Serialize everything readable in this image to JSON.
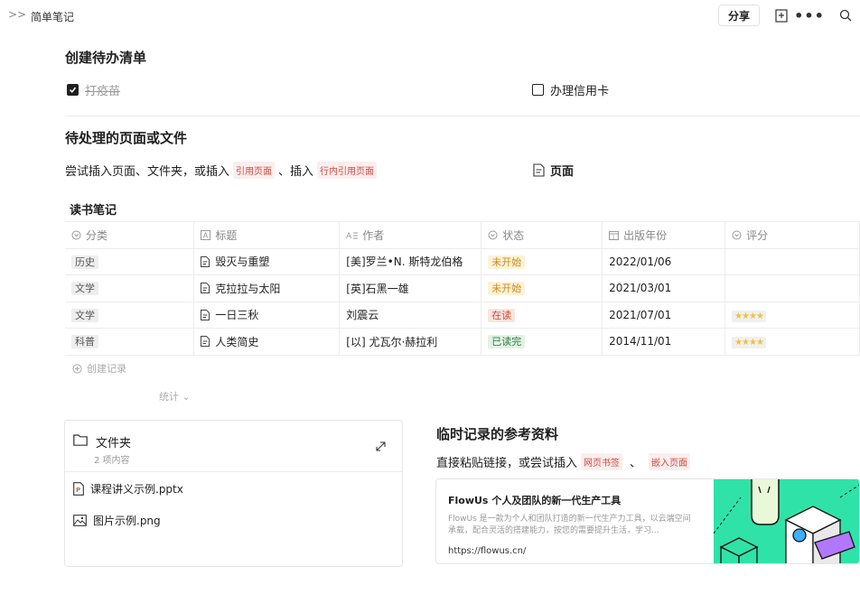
{
  "topbar": {
    "title": "简单笔记",
    "share_label": "分享"
  },
  "todo_section": {
    "heading": "创建待办清单",
    "items": [
      {
        "label": "打疫苗",
        "checked": true
      },
      {
        "label": "办理信用卡",
        "checked": false
      }
    ]
  },
  "pending_section": {
    "heading": "待处理的页面或文件",
    "text_before": "尝试插入页面、文件夹，或插入",
    "tag1": "引用页面",
    "text_mid": "、插入",
    "tag2": "行内引用页面",
    "page_link": "页面"
  },
  "database": {
    "title": "读书笔记",
    "columns": [
      {
        "label": "分类",
        "icon": "select-icon"
      },
      {
        "label": "标题",
        "icon": "text-icon"
      },
      {
        "label": "作者",
        "icon": "text-lines-icon"
      },
      {
        "label": "状态",
        "icon": "select-icon"
      },
      {
        "label": "出版年份",
        "icon": "calendar-icon"
      },
      {
        "label": "评分",
        "icon": "select-icon"
      }
    ],
    "rows": [
      {
        "category": "历史",
        "title": "毁灭与重塑",
        "author": "[美]罗兰•N. 斯特龙伯格",
        "status": "未开始",
        "status_color": "orange",
        "year": "2022/01/06",
        "rating": ""
      },
      {
        "category": "文学",
        "title": "克拉拉与太阳",
        "author": "[英]石黑一雄",
        "status": "未开始",
        "status_color": "orange",
        "year": "2021/03/01",
        "rating": ""
      },
      {
        "category": "文学",
        "title": "一日三秋",
        "author": "刘震云",
        "status": "在读",
        "status_color": "red",
        "year": "2021/07/01",
        "rating": "★★★★"
      },
      {
        "category": "科普",
        "title": "人类简史",
        "author": "[以] 尤瓦尔·赫拉利",
        "status": "已读完",
        "status_color": "green",
        "year": "2014/11/01",
        "rating": "★★★★"
      }
    ],
    "create_label": "创建记录",
    "stats_label": "统计"
  },
  "folder": {
    "name": "文件夹",
    "count": "2 项内容",
    "files": [
      {
        "name": "课程讲义示例.pptx",
        "icon": "pptx-file-icon"
      },
      {
        "name": "图片示例.png",
        "icon": "image-file-icon"
      }
    ]
  },
  "reference": {
    "heading": "临时记录的参考资料",
    "text_before": "直接粘贴链接，或尝试插入",
    "tag1": "网页书签",
    "sep": "、",
    "tag2": "嵌入页面",
    "bookmark": {
      "title": "FlowUs 个人及团队的新一代生产工具",
      "desc": "FlowUs 是一款为个人和团队打造的新一代生产力工具，以云端空间承载，配合灵活的搭建能力，按您的需要提升生活，学习...",
      "url": "https://flowus.cn/"
    }
  },
  "colors": {
    "accent_red": "#d04a3f",
    "bookmark_image_green": "#2fe3a8"
  }
}
